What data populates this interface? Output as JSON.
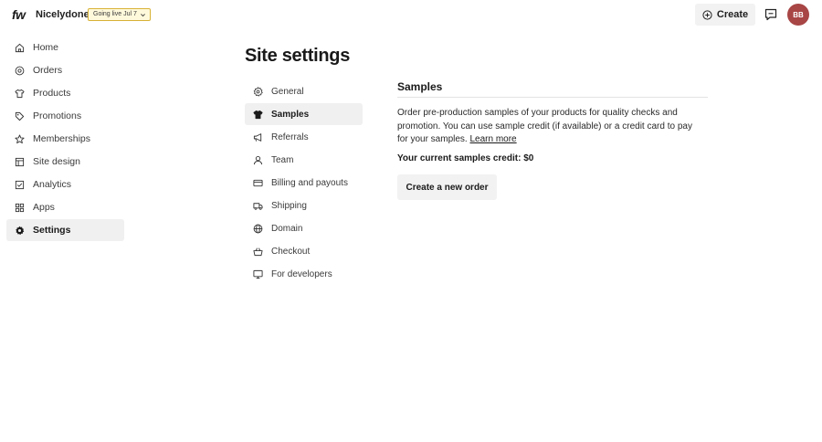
{
  "header": {
    "logo_text": "fw",
    "store_name": "Nicelydone",
    "golive_label": "Going live Jul 7",
    "create_label": "Create",
    "avatar_initials": "BB",
    "avatar_color": "#a84545"
  },
  "sidebar": {
    "items": [
      {
        "label": "Home",
        "icon": "home-icon"
      },
      {
        "label": "Orders",
        "icon": "orders-icon"
      },
      {
        "label": "Products",
        "icon": "shirt-icon"
      },
      {
        "label": "Promotions",
        "icon": "tag-icon"
      },
      {
        "label": "Memberships",
        "icon": "star-icon"
      },
      {
        "label": "Site design",
        "icon": "layout-icon"
      },
      {
        "label": "Analytics",
        "icon": "checkbox-icon"
      },
      {
        "label": "Apps",
        "icon": "grid-icon"
      },
      {
        "label": "Settings",
        "icon": "gear-icon",
        "active": true
      }
    ]
  },
  "page": {
    "title": "Site settings"
  },
  "settings_nav": {
    "items": [
      {
        "label": "General",
        "icon": "gear-icon"
      },
      {
        "label": "Samples",
        "icon": "shirt-icon",
        "active": true
      },
      {
        "label": "Referrals",
        "icon": "megaphone-icon"
      },
      {
        "label": "Team",
        "icon": "person-icon"
      },
      {
        "label": "Billing and payouts",
        "icon": "card-icon"
      },
      {
        "label": "Shipping",
        "icon": "truck-icon"
      },
      {
        "label": "Domain",
        "icon": "globe-icon"
      },
      {
        "label": "Checkout",
        "icon": "basket-icon"
      },
      {
        "label": "For developers",
        "icon": "monitor-icon"
      }
    ]
  },
  "samples": {
    "title": "Samples",
    "description": "Order pre-production samples of your products for quality checks and promotion. You can use sample credit (if available) or a credit card to pay for your samples.",
    "learn_more": "Learn more",
    "credit": "Your current samples credit: $0",
    "order_button": "Create a new order"
  }
}
